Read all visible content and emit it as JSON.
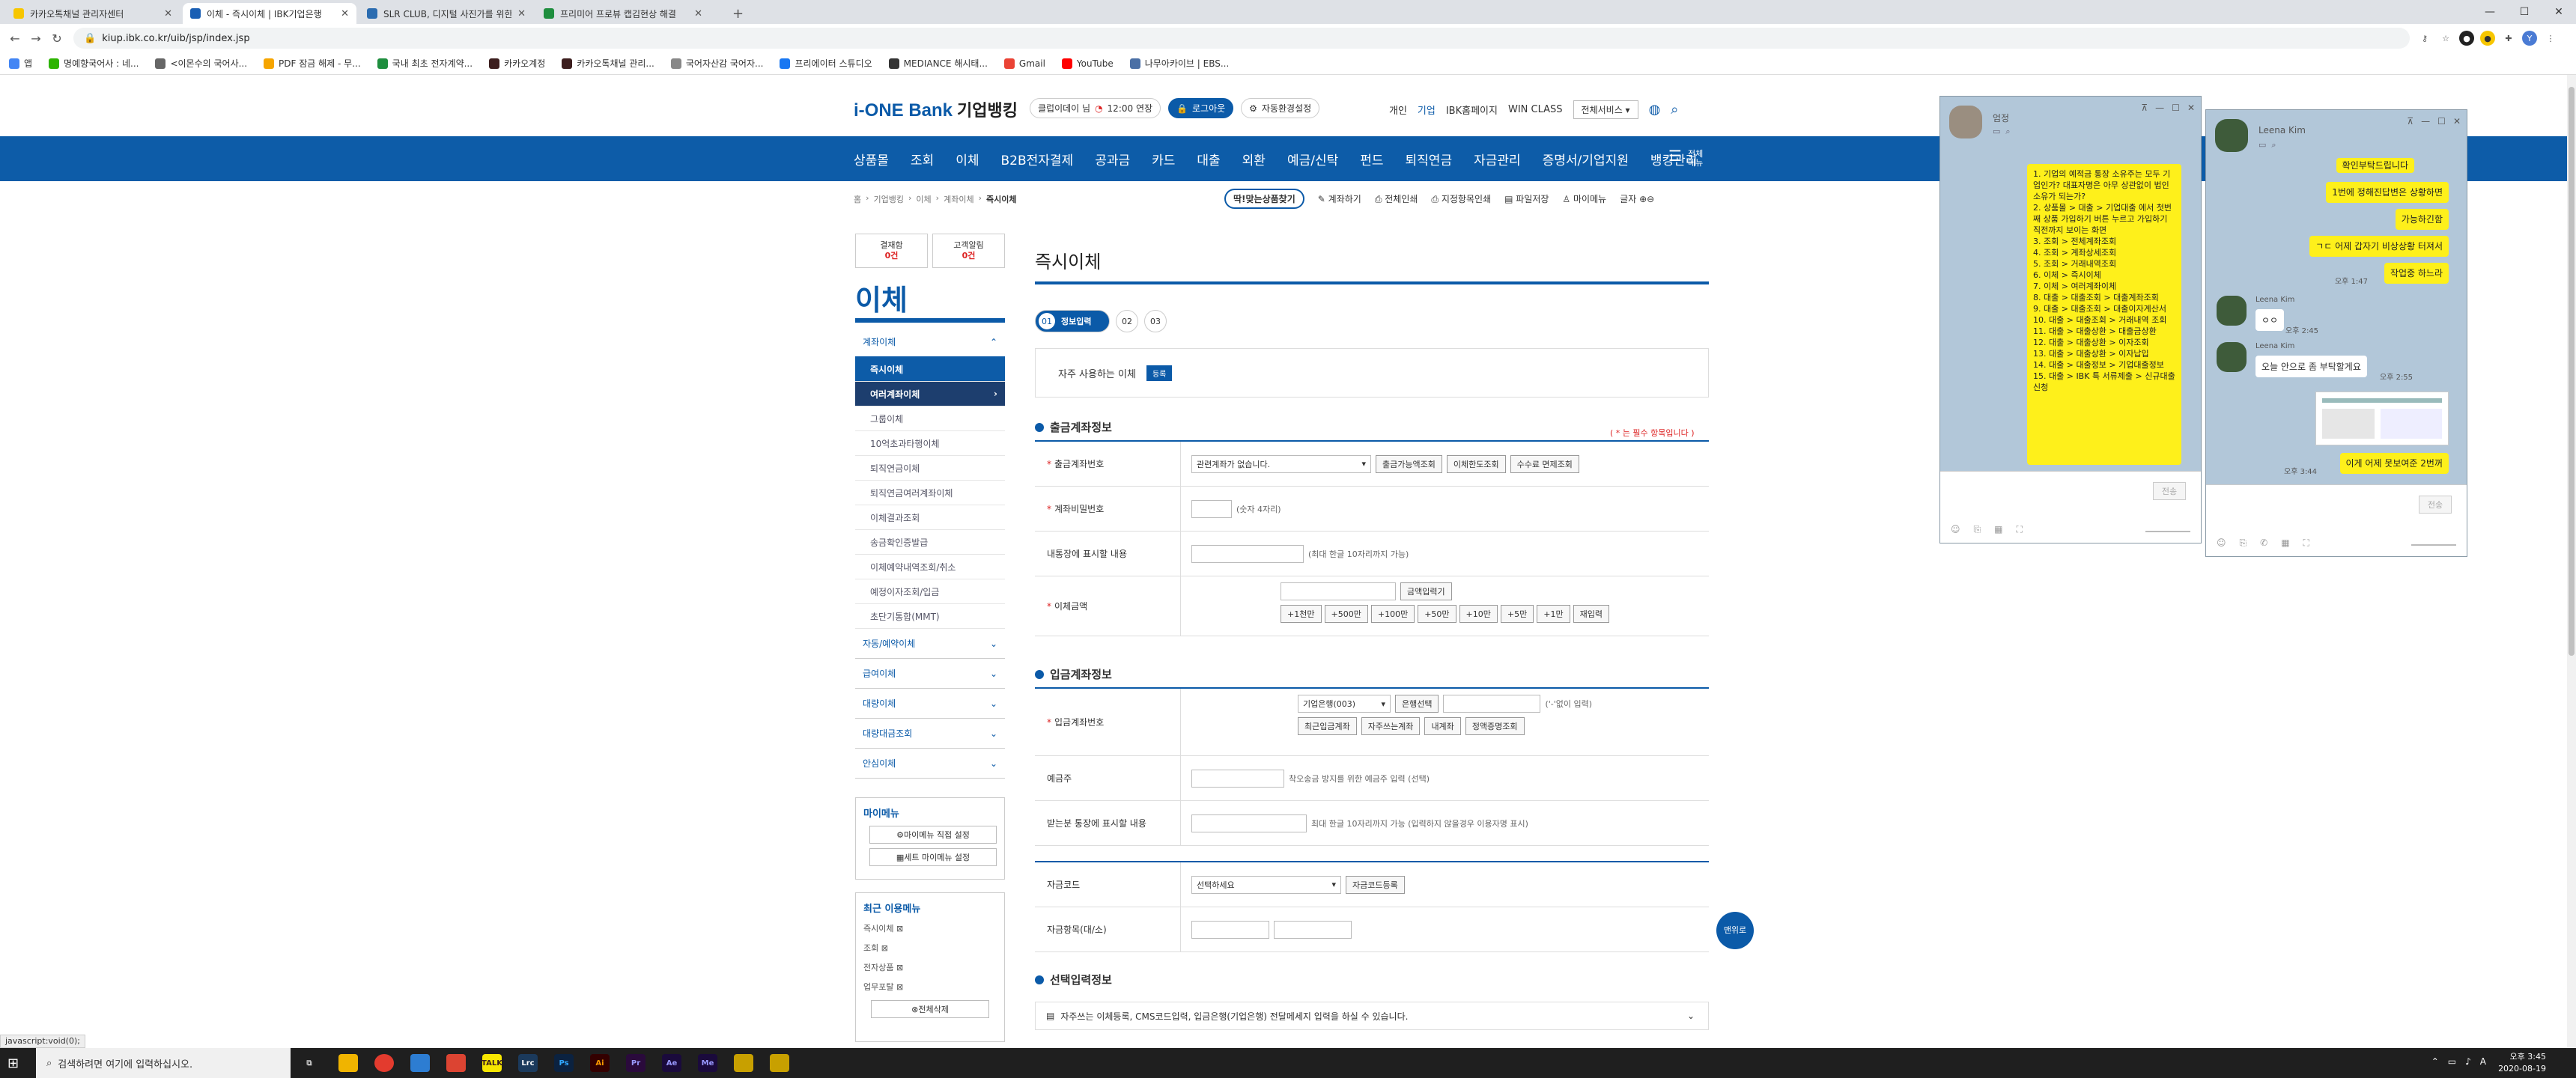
{
  "browser": {
    "tabs": [
      {
        "title": "카카오톡채널 관리자센터",
        "color": "#f7c600"
      },
      {
        "title": "이체 - 즉시이체 | IBK기업은행",
        "color": "#1a5fb4"
      },
      {
        "title": "SLR CLUB, 디지털 사진가를 위한",
        "color": "#2b6cb0"
      },
      {
        "title": "프리미어 프로뷰 캡김현상 해결",
        "color": "#1e8e3e"
      }
    ],
    "url": "kiup.ibk.co.kr/uib/jsp/index.jsp",
    "bookmarks": [
      {
        "label": "앱",
        "color": "#4285f4"
      },
      {
        "label": "명예향국어사 : 네...",
        "color": "#2db400"
      },
      {
        "label": "<이몬수의 국어사...",
        "color": "#666666"
      },
      {
        "label": "PDF 잠금 해제 - 무...",
        "color": "#f6a500"
      },
      {
        "label": "국내 최초 전자계약...",
        "color": "#1e8e3e"
      },
      {
        "label": "카카오계정",
        "color": "#3c1e1e"
      },
      {
        "label": "카카오톡채널 관리...",
        "color": "#3c1e1e"
      },
      {
        "label": "국어자산감 국어자...",
        "color": "#888888"
      },
      {
        "label": "프리에이터 스튜디오",
        "color": "#1877f2"
      },
      {
        "label": "MEDIANCE 해시태...",
        "color": "#333333"
      },
      {
        "label": "Gmail",
        "color": "#ea4335"
      },
      {
        "label": "YouTube",
        "color": "#ff0000"
      },
      {
        "label": "나무아카이브 | EBS...",
        "color": "#4a6fa5"
      }
    ]
  },
  "header": {
    "logo": "i-ONE Bank",
    "logo_sub": "기업뱅킹",
    "timer_label": "클럽이데이 님",
    "timer_value": "12:00 연장",
    "logout": "로그아웃",
    "auto_setting": "자동환경설정",
    "top_links": [
      "개인",
      "기업",
      "IBK홈페이지",
      "WIN CLASS"
    ],
    "all_services": "전체서비스",
    "nav": [
      "상품몰",
      "조회",
      "이체",
      "B2B전자결제",
      "공과금",
      "카드",
      "대출",
      "외환",
      "예금/신탁",
      "펀드",
      "퇴직연금",
      "자금관리",
      "증명서/기업지원",
      "뱅킹관리"
    ],
    "nav_more": "전체메뉴"
  },
  "breadcrumb": [
    "홈",
    "기업뱅킹",
    "이체",
    "계좌이체",
    "즉시이체"
  ],
  "utils": [
    "딱!맞는상품찾기",
    "계좌하기",
    "전체인쇄",
    "지정항목인쇄",
    "파일저장",
    "마이메뉴",
    "글자"
  ],
  "sidebar": {
    "quick": [
      {
        "label": "결재함",
        "count": "0건"
      },
      {
        "label": "고객알림",
        "count": "0건"
      }
    ],
    "title": "이체",
    "group_open": "계좌이체",
    "items": [
      "즉시이체",
      "여러계좌이체",
      "그룹이체",
      "10억초과타행이체",
      "퇴직연금이체",
      "퇴직연금여러계좌이체",
      "이체결과조회",
      "송금확인증발급",
      "이체예약내역조회/취소",
      "예정이자조회/입금",
      "초단기통합(MMT)"
    ],
    "groups": [
      "자동/예약이체",
      "급여이체",
      "대량이체",
      "대량대금조회",
      "안심이체"
    ],
    "mymenu_title": "마이메뉴",
    "mymenu_buttons": [
      "마이메뉴 직접 설정",
      "세트 마이메뉴 설정"
    ],
    "recent_title": "최근 이용메뉴",
    "recent": [
      "즉시이체",
      "조회",
      "전자상품",
      "업무포탈"
    ],
    "delete_all": "전체삭제"
  },
  "content": {
    "title": "즉시이체",
    "steps": [
      {
        "num": "01",
        "label": "정보입력"
      },
      {
        "num": "02"
      },
      {
        "num": "03"
      }
    ],
    "fav_label": "자주 사용하는 이체",
    "fav_btn": "등록",
    "required_hint": "( * 는 필수 항목입니다 )",
    "out_section": "출금계좌정보",
    "out_rows": {
      "account_label": "출금계좌번호",
      "account_select": "관련계좌가 없습니다.",
      "account_buttons": [
        "출금가능액조회",
        "이체한도조회",
        "수수료 면제조회"
      ],
      "pw_label": "계좌비밀번호",
      "pw_note": "(숫자 4자리)",
      "memo_label": "내통장에 표시할 내용",
      "memo_note": "(최대 한글 10자리까지 가능)",
      "amount_label": "이체금액",
      "amount_btn": "금액입력기",
      "amount_quick": [
        "+1천만",
        "+500만",
        "+100만",
        "+50만",
        "+10만",
        "+5만",
        "+1만",
        "재입력"
      ]
    },
    "in_section": "입금계좌정보",
    "in_rows": {
      "account_label": "입금계좌번호",
      "bank_select": "기업은행(003)",
      "bank_btn": "은행선택",
      "hyphen_note": "('-'없이 입력)",
      "account_buttons": [
        "최근입금계좌",
        "자주쓰는계좌",
        "내계좌",
        "정액증명조회"
      ],
      "holder_label": "예금주",
      "holder_note": "착오송금 방지를 위한 예금주 입력 (선택)",
      "memo_label": "받는분 통장에 표시할 내용",
      "memo_note": "최대 한글 10자리까지 가능 (입력하지 않을경우 이용자명 표시)"
    },
    "fund_rows": {
      "code_label": "자금코드",
      "code_select": "선택하세요",
      "code_btn": "자금코드등록",
      "item_label": "자금항목(대/소)"
    },
    "opt_section": "선택입력정보",
    "cms_text": "자주쓰는 이체등록, CMS코드입력, 입금은행(기업은행) 전달메세지 입력을 하실 수 있습니다.",
    "float_btn": "맨위로"
  },
  "chat1": {
    "name": "엄정",
    "message": "1. 기업의 예적금 통장 소유주는 모두 기업인가? 대표자명은 아무 상관없이 법인 소유가 되는가?\n2. 상품몰 > 대출 > 기업대출 에서 첫번째 상품 가입하기 버튼 누르고 가입하기 직전까지 보이는 화면\n3. 조회 > 전체계좌조회\n4. 조회 > 계좌상세조회\n5. 조회 > 거래내역조회\n6. 이체 > 즉시이체\n7. 이체 > 여러계좌이체\n8. 대출 > 대출조회 > 대출계좌조회\n9. 대출 > 대출조회 > 대출이자계산서\n10. 대출 > 대출조회 > 거래내역 조회\n11. 대출 > 대출상환 > 대출금상환\n12. 대출 > 대출상환 > 이자조회\n13. 대출 > 대출상환 > 이자납입\n14. 대출 > 대출정보 > 기업대출정보\n15. 대출 > IBK 특 서류제출 > 신규대출신청",
    "send": "전송"
  },
  "chat2": {
    "name": "Leena Kim",
    "my_msgs": [
      "확인부탁드립니다",
      "1번에 정해진답변은 상황하면",
      "가능하긴함",
      "ㄱㄷ 어제 갑자기 비상상황 터져서",
      "작업중 하느라"
    ],
    "my_time": "오후 1:47",
    "other_name": "Leena Kim",
    "other_msg1": "ㅇㅇ",
    "other_time1": "오후 2:45",
    "other_msg2": "오늘 안으로 좀 부탁할게요",
    "other_time2": "오후 2:55",
    "last_msg": "이게 어제 못보여준 2번꺼",
    "last_time": "오후 3:44",
    "send": "전송"
  },
  "taskbar": {
    "search": "검색하려면 여기에 입력하십시오.",
    "icons": [
      {
        "label": "",
        "color": "#3a3a3a"
      },
      {
        "label": "",
        "color": "#f0b400"
      },
      {
        "label": "",
        "color": "#e33b2e"
      },
      {
        "label": "",
        "color": "#2d7dd2"
      },
      {
        "label": "",
        "color": "#dc4432"
      },
      {
        "label": "TALK",
        "color": "#f7e600"
      },
      {
        "label": "Lrc",
        "color": "#1b3a5c"
      },
      {
        "label": "Ps",
        "color": "#0b2240"
      },
      {
        "label": "Ai",
        "color": "#330000"
      },
      {
        "label": "Pr",
        "color": "#2a0a3c"
      },
      {
        "label": "Ae",
        "color": "#1a0a3c"
      },
      {
        "label": "Me",
        "color": "#1a0a3c"
      },
      {
        "label": "",
        "color": "#c8a000"
      },
      {
        "label": "",
        "color": "#c8a000"
      }
    ],
    "time": "오후 3:45",
    "date": "2020-08-19"
  },
  "status_url": "javascript:void(0);"
}
